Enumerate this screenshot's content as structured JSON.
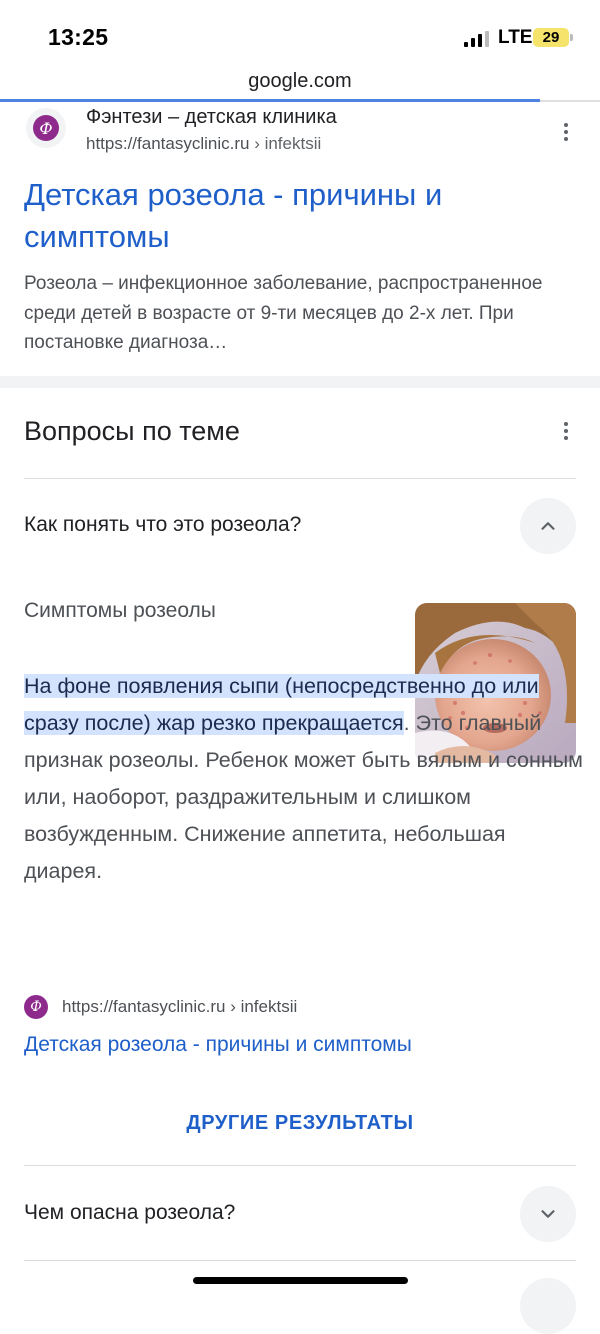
{
  "status": {
    "time": "13:25",
    "network": "LTE",
    "battery": "29"
  },
  "browser": {
    "url": "google.com",
    "load_progress": 0.9
  },
  "result": {
    "site_name": "Фэнтези – детская клиника",
    "url": "https://fantasyclinic.ru",
    "url_path": " › infektsii",
    "title": "Детская розеола - причины и симптомы",
    "snippet": "Розеола – инфекционное заболевание, распространенное среди детей в возрасте от 9-ти месяцев до 2-х лет. При постановке диагноза…",
    "favicon_letter": "Ф"
  },
  "paa": {
    "title": "Вопросы по теме",
    "q1": "Как понять что это розеола?",
    "answer_heading": "Симптомы розеолы",
    "answer_highlight": "На фоне появления сыпи (непосредственно до или сразу после) жар резко прекращается",
    "answer_rest": ". Это главный признак розеолы. Ребенок может быть вялым и сонным или, наоборот, раздражительным и слишком возбужденным. Снижение аппетита, небольшая диарея.",
    "source_url": "https://fantasyclinic.ru",
    "source_path": " › infektsii",
    "source_link": "Детская розеола - причины и симптомы",
    "more": "ДРУГИЕ РЕЗУЛЬТАТЫ",
    "q2": "Чем опасна розеола?"
  },
  "colors": {
    "link": "#1f5fc9",
    "highlight": "#d3e3fd",
    "favicon": "#8e2a8b"
  }
}
